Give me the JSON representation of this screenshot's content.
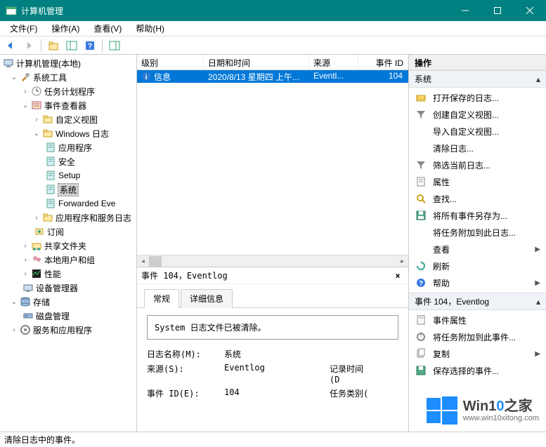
{
  "window": {
    "title": "计算机管理"
  },
  "menu": {
    "file": "文件(F)",
    "action": "操作(A)",
    "view": "查看(V)",
    "help": "帮助(H)"
  },
  "tree": {
    "root": "计算机管理(本地)",
    "systools": "系统工具",
    "tasksched": "任务计划程序",
    "eventviewer": "事件查看器",
    "customviews": "自定义视图",
    "winlogs": "Windows 日志",
    "application": "应用程序",
    "security": "安全",
    "setup": "Setup",
    "system": "系统",
    "forwarded": "Forwarded Eve",
    "appservlogs": "应用程序和服务日志",
    "subscriptions": "订阅",
    "sharedfolders": "共享文件夹",
    "localusers": "本地用户和组",
    "performance": "性能",
    "devicemgr": "设备管理器",
    "storage": "存储",
    "diskmgmt": "磁盘管理",
    "services": "服务和应用程序"
  },
  "columns": {
    "level": "级别",
    "datetime": "日期和时间",
    "source": "来源",
    "eventid": "事件 ID"
  },
  "colwidths": {
    "level": 95,
    "datetime": 150,
    "source": 70,
    "eventid": 55
  },
  "row": {
    "level": "信息",
    "datetime": "2020/8/13 星期四 上午...",
    "source": "Eventl...",
    "eventid": "104"
  },
  "details": {
    "title": "事件 104，Eventlog",
    "tab_general": "常规",
    "tab_details": "详细信息",
    "message": "System 日志文件已被清除。",
    "logname_k": "日志名称(M):",
    "logname_v": "系统",
    "source_k": "来源(S):",
    "source_v": "Eventlog",
    "logged_k": "记录时间(D",
    "eventid_k": "事件 ID(E):",
    "eventid_v": "104",
    "taskcat_k": "任务类别("
  },
  "actions": {
    "header": "操作",
    "group1": "系统",
    "open_saved": "打开保存的日志...",
    "create_custom": "创建自定义视图...",
    "import_custom": "导入自定义视图...",
    "clear_log": "清除日志...",
    "filter_log": "筛选当前日志...",
    "properties": "属性",
    "find": "查找...",
    "save_all": "将所有事件另存为...",
    "attach_task": "将任务附加到此日志...",
    "view": "查看",
    "refresh": "刷新",
    "help": "帮助",
    "group2": "事件 104，Eventlog",
    "event_props": "事件属性",
    "attach_event": "将任务附加到此事件...",
    "copy": "复制",
    "save_sel": "保存选择的事件..."
  },
  "statusbar": "清除日志中的事件。",
  "watermark": {
    "line1a": "Win1",
    "line1b": "0",
    "line1c": "之家",
    "line2": "www.win10xitong.com"
  }
}
